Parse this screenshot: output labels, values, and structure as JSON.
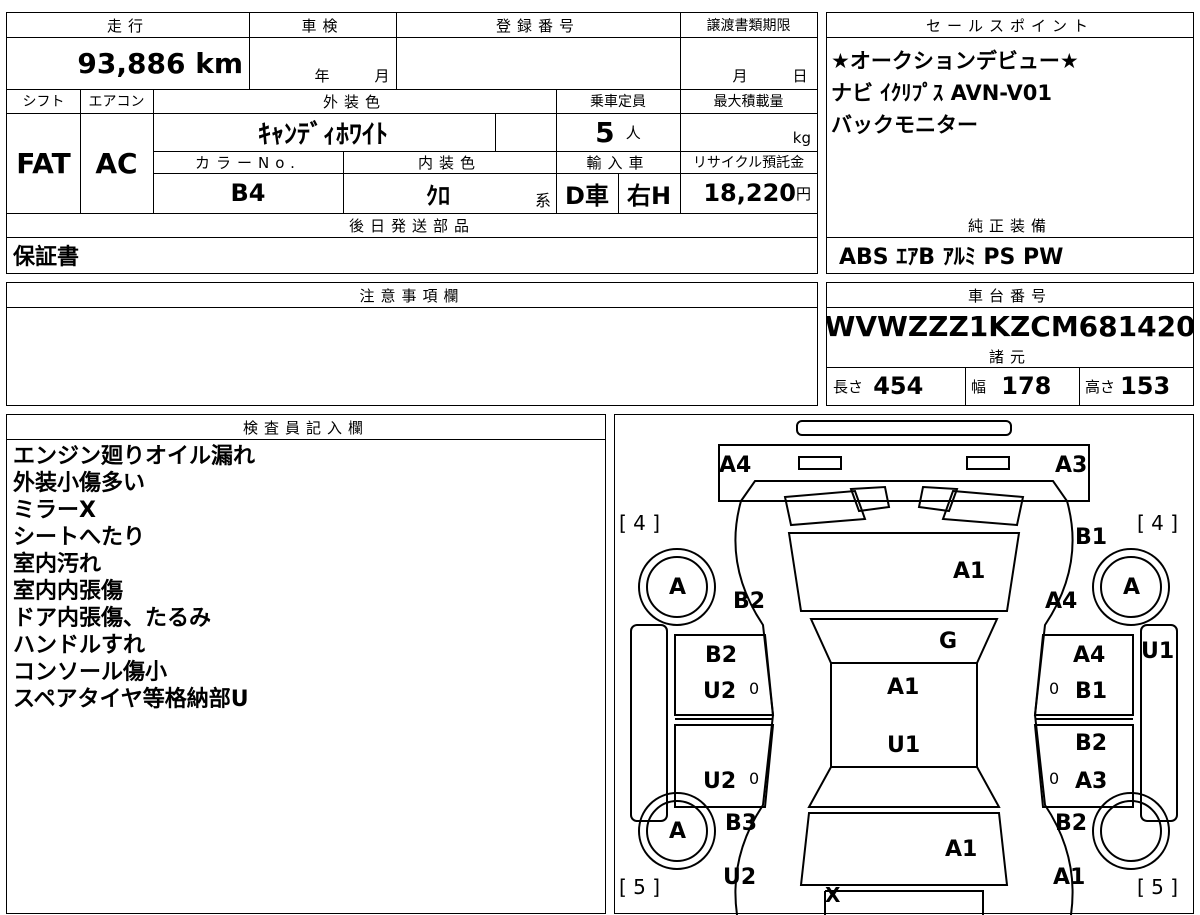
{
  "vehicle": {
    "mileage_label": "走行",
    "mileage_value": "93,886",
    "mileage_unit": "km",
    "inspection_label": "車検",
    "inspection_year": "年",
    "inspection_month": "月",
    "registration_label": "登録番号",
    "registration_value": "",
    "transfer_deadline_label": "譲渡書類期限",
    "transfer_month": "月",
    "transfer_day": "日",
    "shift_label": "シフト",
    "shift_value": "FAT",
    "ac_label": "エアコン",
    "ac_value": "AC",
    "exterior_color_label": "外装色",
    "exterior_color_value": "ｷｬﾝﾃﾞｨﾎﾜｲﾄ",
    "capacity_label": "乗車定員",
    "capacity_value": "5",
    "capacity_unit": "人",
    "max_load_label": "最大積載量",
    "max_load_unit": "kg",
    "color_no_label": "カラーNo.",
    "color_no_value": "B4",
    "interior_color_label": "内装色",
    "interior_color_value": "ｸﾛ",
    "interior_suffix": "系",
    "import_label": "輸入車",
    "import_dealer": "D車",
    "import_handle": "右H",
    "recycle_label": "リサイクル預託金",
    "recycle_value": "18,220",
    "recycle_unit": "円",
    "later_parts_label": "後日発送部品",
    "later_parts_value": "保証書"
  },
  "sales_points": {
    "label": "セールスポイント",
    "lines": [
      "★オークションデビュー★",
      "ナビ ｲｸﾘﾌﾟｽ AVN-V01",
      "バックモニター"
    ]
  },
  "genuine_equipment": {
    "label": "純正装備",
    "value": "ABS ｴｱB ｱﾙﾐ PS PW"
  },
  "caution": {
    "label": "注意事項欄"
  },
  "chassis": {
    "label": "車台番号",
    "value": "WVWZZZ1KZCM681420"
  },
  "specs": {
    "label": "諸元",
    "length_label": "長さ",
    "length_value": "454",
    "width_label": "幅",
    "width_value": "178",
    "height_label": "高さ",
    "height_value": "153"
  },
  "inspector": {
    "label": "検査員記入欄",
    "notes": [
      "エンジン廻りオイル漏れ",
      "外装小傷多い",
      "ミラーX",
      "シートへたり",
      "室内汚れ",
      "室内内張傷",
      "ドア内張傷、たるみ",
      "ハンドルすれ",
      "コンソール傷小",
      "スペアタイヤ等格納部U"
    ]
  },
  "diagram": {
    "marks": {
      "front_left": "A4",
      "front_right": "A3",
      "tread_front_left": "[ 4 ]",
      "tread_front_right": "[ 4 ]",
      "tread_rear_left": "[ 5 ]",
      "tread_rear_right": "[ 5 ]",
      "hood": "A1",
      "windshield": "G",
      "roof_front": "A1",
      "roof_rear": "U1",
      "fender_fl": "B2",
      "fender_fr_top": "B1",
      "fender_fr": "A4",
      "wheel_fl": "A",
      "wheel_fr": "A",
      "wheel_rl": "A",
      "door_fl_1": "B2",
      "door_fl_2": "U2",
      "door_fr_1": "A4",
      "door_fr_2": "B1",
      "door_rl": "U2",
      "door_rr_1": "B2",
      "door_rr_2": "A3",
      "pillar_r": "U1",
      "quarter_rl": "B3",
      "quarter_rl_2": "U2",
      "quarter_rr": "B2",
      "quarter_rr_2": "A1",
      "trunk": "A1",
      "rear": "X",
      "zero_fl": "0",
      "zero_fr": "0",
      "zero_rl": "0",
      "zero_rr": "0"
    }
  }
}
